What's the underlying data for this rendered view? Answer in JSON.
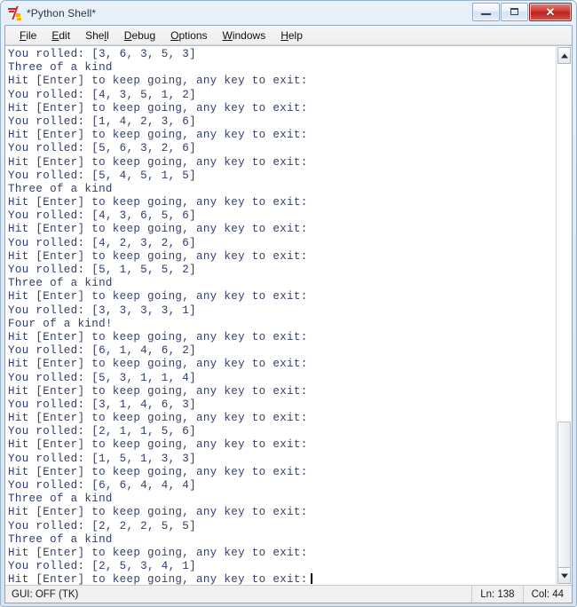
{
  "window": {
    "title": "*Python Shell*",
    "icon": "python-idle-icon",
    "controls": {
      "minimize": "minimize-button",
      "maximize": "maximize-button",
      "close_glyph": "✕"
    }
  },
  "menubar": {
    "items": [
      {
        "label": "File",
        "mnemonic": "F"
      },
      {
        "label": "Edit",
        "mnemonic": "E"
      },
      {
        "label": "Shell",
        "mnemonic": "l"
      },
      {
        "label": "Debug",
        "mnemonic": "D"
      },
      {
        "label": "Options",
        "mnemonic": "O"
      },
      {
        "label": "Windows",
        "mnemonic": "W"
      },
      {
        "label": "Help",
        "mnemonic": "H"
      }
    ]
  },
  "shell": {
    "text_color": "#353f6b",
    "background": "#ffffff",
    "lines": [
      "You rolled: [3, 6, 3, 5, 3]",
      "Three of a kind",
      "Hit [Enter] to keep going, any key to exit:",
      "You rolled: [4, 3, 5, 1, 2]",
      "Hit [Enter] to keep going, any key to exit:",
      "You rolled: [1, 4, 2, 3, 6]",
      "Hit [Enter] to keep going, any key to exit:",
      "You rolled: [5, 6, 3, 2, 6]",
      "Hit [Enter] to keep going, any key to exit:",
      "You rolled: [5, 4, 5, 1, 5]",
      "Three of a kind",
      "Hit [Enter] to keep going, any key to exit:",
      "You rolled: [4, 3, 6, 5, 6]",
      "Hit [Enter] to keep going, any key to exit:",
      "You rolled: [4, 2, 3, 2, 6]",
      "Hit [Enter] to keep going, any key to exit:",
      "You rolled: [5, 1, 5, 5, 2]",
      "Three of a kind",
      "Hit [Enter] to keep going, any key to exit:",
      "You rolled: [3, 3, 3, 3, 1]",
      "Four of a kind!",
      "Hit [Enter] to keep going, any key to exit:",
      "You rolled: [6, 1, 4, 6, 2]",
      "Hit [Enter] to keep going, any key to exit:",
      "You rolled: [5, 3, 1, 1, 4]",
      "Hit [Enter] to keep going, any key to exit:",
      "You rolled: [3, 1, 4, 6, 3]",
      "Hit [Enter] to keep going, any key to exit:",
      "You rolled: [2, 1, 1, 5, 6]",
      "Hit [Enter] to keep going, any key to exit:",
      "You rolled: [1, 5, 1, 3, 3]",
      "Hit [Enter] to keep going, any key to exit:",
      "You rolled: [6, 6, 4, 4, 4]",
      "Three of a kind",
      "Hit [Enter] to keep going, any key to exit:",
      "You rolled: [2, 2, 2, 5, 5]",
      "Three of a kind",
      "Hit [Enter] to keep going, any key to exit:",
      "You rolled: [2, 5, 3, 4, 1]"
    ],
    "last_line": "Hit [Enter] to keep going, any key to exit:"
  },
  "scrollbar": {
    "orientation": "vertical",
    "up_arrow": "▲",
    "down_arrow": "▼",
    "thumb_top_percent": 71,
    "thumb_height_percent": 29
  },
  "statusbar": {
    "gui_state": "GUI: OFF (TK)",
    "line": "Ln: 138",
    "column": "Col: 44"
  }
}
